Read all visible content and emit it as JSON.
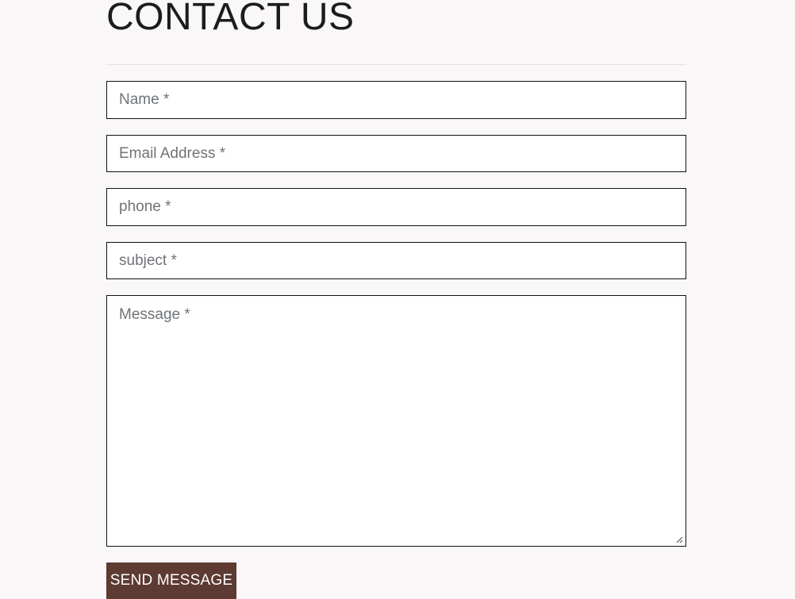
{
  "contact": {
    "title": "CONTACT US",
    "fields": {
      "name_placeholder": "Name *",
      "email_placeholder": "Email Address *",
      "phone_placeholder": "phone *",
      "subject_placeholder": "subject *",
      "message_placeholder": "Message *"
    },
    "send_label": "SEND MESSAGE"
  },
  "colors": {
    "background": "#f9f7f7",
    "button": "#5d3a32",
    "field_border": "#111111",
    "title_text": "#1c1c1c"
  },
  "icons": {
    "resize_grip": "resize-grip-icon"
  }
}
